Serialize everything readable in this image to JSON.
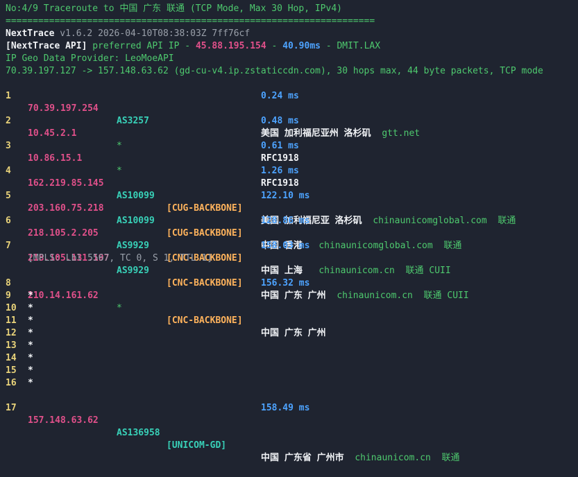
{
  "header": {
    "title": "No:4/9 Traceroute to 中国 广东 联通 (TCP Mode, Max 30 Hop, IPv4)",
    "separator": "====================================================================",
    "version_line": {
      "app": "NextTrace",
      "meta": "v1.6.2 2026-04-10T08:38:03Z 7ff76cf"
    },
    "api_line": {
      "tag": "[NextTrace API]",
      "text": "preferred API IP -",
      "ip": "45.88.195.154",
      "dash1": "-",
      "latency": "40.90ms",
      "dash2": "-",
      "node": "DMIT.LAX"
    },
    "provider_line": "IP Geo Data Provider: LeoMoeAPI",
    "route_line": "70.39.197.127 -> 157.148.63.62 (gd-cu-v4.ip.zstaticcdn.com), 30 hops max, 44 byte packets, TCP mode"
  },
  "colors": {
    "background": "#1f2430",
    "green": "#4ec96e",
    "pink": "#e0508a",
    "blue": "#4da3ff",
    "orange": "#ffb35c",
    "cyan": "#38d1b8"
  },
  "hops": [
    {
      "num": "1",
      "ip": "70.39.197.254",
      "as": "AS3257",
      "tag": "",
      "geo": "美国 加利福尼亚州 洛杉矶",
      "org": "gtt.net",
      "isp": "",
      "rtt": "0.24 ms"
    },
    {
      "num": "2",
      "ip": "10.45.2.1",
      "as": "*",
      "tag": "",
      "geo": "RFC1918",
      "org": "",
      "isp": "",
      "rtt": "0.48 ms"
    },
    {
      "num": "3",
      "ip": "10.86.15.1",
      "as": "*",
      "tag": "",
      "geo": "RFC1918",
      "org": "",
      "isp": "",
      "rtt": "0.61 ms"
    },
    {
      "num": "4",
      "ip": "162.219.85.145",
      "as": "AS10099",
      "tag": "[CUG-BACKBONE]",
      "geo": "美国 加利福尼亚 洛杉矶",
      "org": "chinaunicomglobal.com",
      "isp": "联通",
      "rtt": "1.26 ms"
    },
    {
      "num": "5",
      "ip": "203.160.75.218",
      "as": "AS10099",
      "tag": "[CUG-BACKBONE]",
      "geo": "中国 香港",
      "org": "chinaunicomglobal.com",
      "isp": "联通",
      "rtt": "122.10 ms"
    },
    {
      "num": "6",
      "ip": "218.105.2.205",
      "as": "AS9929",
      "tag": "[CNC-BACKBONE]",
      "geo": "中国 上海",
      "org": "chinaunicom.cn",
      "isp": "联通 CUII",
      "rtt": "128.86 ms"
    },
    {
      "num": "7",
      "ip": "218.105.131.197",
      "as": "AS9929",
      "tag": "[CNC-BACKBONE]",
      "geo": "中国 广东 广州",
      "org": "chinaunicom.cn",
      "isp": "联通 CUII",
      "rtt": "158.03 ms"
    }
  ],
  "mpls": "[MPLS: Lbl 5567, TC 0, S 1, TTL 1]",
  "hop8": {
    "num": "8",
    "ip": "210.14.161.62",
    "as": "*",
    "tag": "[CNC-BACKBONE]",
    "geo": "中国 广东 广州",
    "rtt": "156.32 ms"
  },
  "stars": [
    {
      "num": "9",
      "mark": "*"
    },
    {
      "num": "10",
      "mark": "*"
    },
    {
      "num": "11",
      "mark": "*"
    },
    {
      "num": "12",
      "mark": "*"
    },
    {
      "num": "13",
      "mark": "*"
    },
    {
      "num": "14",
      "mark": "*"
    },
    {
      "num": "15",
      "mark": "*"
    },
    {
      "num": "16",
      "mark": "*"
    }
  ],
  "hop17": {
    "num": "17",
    "ip": "157.148.63.62",
    "as": "AS136958",
    "tag": "[UNICOM-GD]",
    "geo": "中国 广东省 广州市",
    "org": "chinaunicom.cn",
    "isp": "联通",
    "rtt": "158.49 ms"
  }
}
